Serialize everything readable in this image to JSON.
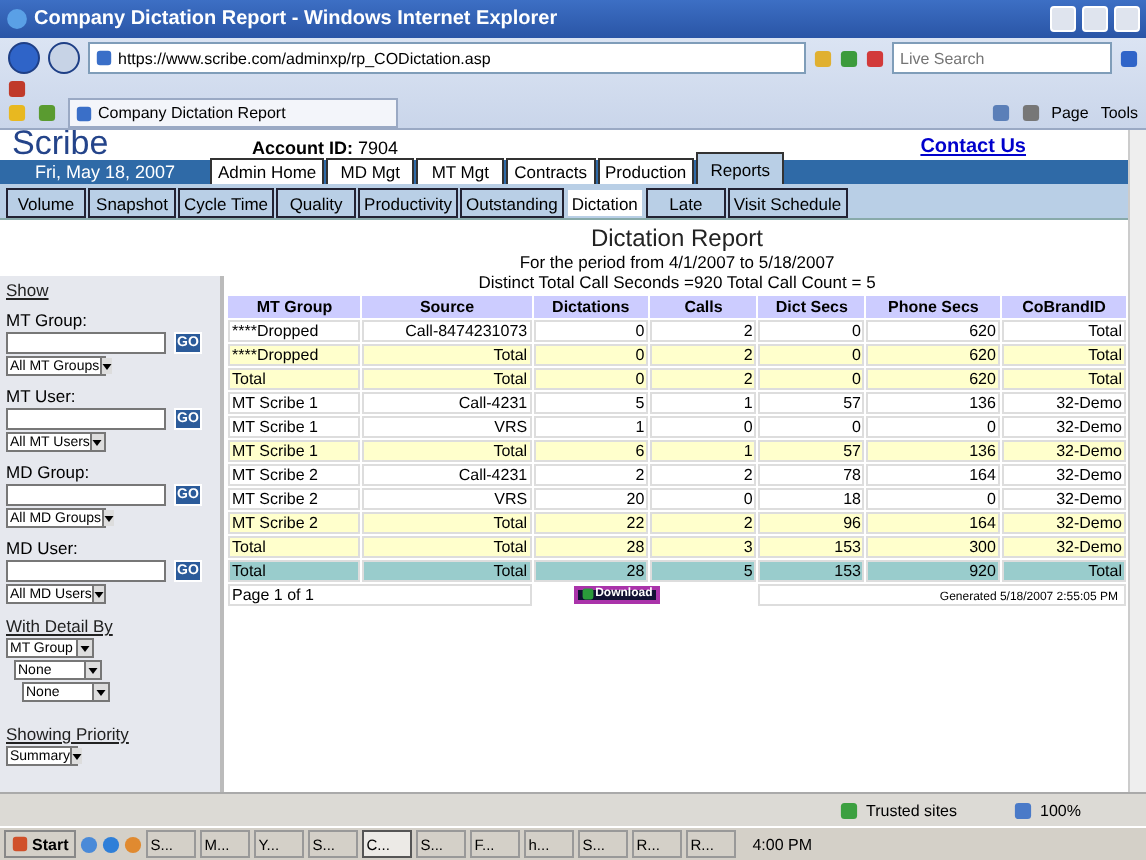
{
  "window": {
    "title": "Company Dictation Report - Windows Internet Explorer"
  },
  "address_bar": {
    "url": "https://www.scribe.com/adminxp/rp_CODictation.asp",
    "search_placeholder": "Live Search"
  },
  "browser_tab": {
    "title": "Company Dictation Report"
  },
  "command_bar": {
    "buttons": [
      "Page",
      "Tools"
    ]
  },
  "header": {
    "logo": "Scribe",
    "account_label": "Account ID:",
    "account_id": "7904",
    "contact_link": "Contact Us",
    "date": "Fri, May 18, 2007"
  },
  "top_tabs": [
    {
      "label": "Admin Home",
      "selected": false
    },
    {
      "label": "MD Mgt",
      "selected": false
    },
    {
      "label": "MT Mgt",
      "selected": false
    },
    {
      "label": "Contracts",
      "selected": false
    },
    {
      "label": "Production",
      "selected": false
    },
    {
      "label": "Reports",
      "selected": true
    }
  ],
  "sub_tabs": [
    {
      "label": "Volume",
      "selected": false
    },
    {
      "label": "Snapshot",
      "selected": false
    },
    {
      "label": "Cycle Time",
      "selected": false
    },
    {
      "label": "Quality",
      "selected": false
    },
    {
      "label": "Productivity",
      "selected": false
    },
    {
      "label": "Outstanding",
      "selected": false
    },
    {
      "label": "Dictation",
      "selected": true
    },
    {
      "label": "Late",
      "selected": false
    },
    {
      "label": "Visit Schedule",
      "selected": false
    }
  ],
  "sidebar": {
    "show_link": "Show",
    "filters": [
      {
        "label": "MT Group:",
        "go": "GO",
        "select": "All MT Groups"
      },
      {
        "label": "MT User:",
        "go": "GO",
        "select": "All MT Users"
      },
      {
        "label": "MD Group:",
        "go": "GO",
        "select": "All MD Groups"
      },
      {
        "label": "MD User:",
        "go": "GO",
        "select": "All MD Users"
      }
    ],
    "detail_label": "With Detail By",
    "detail_selects": [
      "MT Group",
      "None",
      "None"
    ],
    "priority_label": "Showing Priority",
    "priority_select": "Summary"
  },
  "report": {
    "title": "Dictation Report",
    "period": "For the period from 4/1/2007 to 5/18/2007",
    "summary": "Distinct Total Call Seconds =920 Total Call Count = 5",
    "columns": [
      "MT Group",
      "Source",
      "Dictations",
      "Calls",
      "Dict Secs",
      "Phone Secs",
      "CoBrandID"
    ],
    "rows": [
      {
        "kind": "detail",
        "cells": [
          "****Dropped",
          "Call-8474231073",
          "0",
          "2",
          "0",
          "620",
          "Total"
        ]
      },
      {
        "kind": "subtotal",
        "cells": [
          "****Dropped",
          "Total",
          "0",
          "2",
          "0",
          "620",
          "Total"
        ]
      },
      {
        "kind": "subtotal",
        "cells": [
          "Total",
          "Total",
          "0",
          "2",
          "0",
          "620",
          "Total"
        ]
      },
      {
        "kind": "detail",
        "cells": [
          "MT Scribe 1",
          "Call-4231",
          "5",
          "1",
          "57",
          "136",
          "32-Demo"
        ]
      },
      {
        "kind": "detail",
        "cells": [
          "MT Scribe 1",
          "VRS",
          "1",
          "0",
          "0",
          "0",
          "32-Demo"
        ]
      },
      {
        "kind": "subtotal",
        "cells": [
          "MT Scribe 1",
          "Total",
          "6",
          "1",
          "57",
          "136",
          "32-Demo"
        ]
      },
      {
        "kind": "detail",
        "cells": [
          "MT Scribe 2",
          "Call-4231",
          "2",
          "2",
          "78",
          "164",
          "32-Demo"
        ]
      },
      {
        "kind": "detail",
        "cells": [
          "MT Scribe 2",
          "VRS",
          "20",
          "0",
          "18",
          "0",
          "32-Demo"
        ]
      },
      {
        "kind": "subtotal",
        "cells": [
          "MT Scribe 2",
          "Total",
          "22",
          "2",
          "96",
          "164",
          "32-Demo"
        ]
      },
      {
        "kind": "subtotal",
        "cells": [
          "Total",
          "Total",
          "28",
          "3",
          "153",
          "300",
          "32-Demo"
        ]
      },
      {
        "kind": "grand",
        "cells": [
          "Total",
          "Total",
          "28",
          "5",
          "153",
          "920",
          "Total"
        ]
      }
    ],
    "page_info": "Page 1 of 1",
    "download": "Download",
    "generated": "Generated 5/18/2007 2:55:05 PM"
  },
  "status_bar": {
    "zone": "Trusted sites",
    "zoom": "100%"
  },
  "taskbar": {
    "start": "Start",
    "clock": "4:00 PM",
    "buttons": [
      {
        "label": "S...",
        "selected": false
      },
      {
        "label": "M...",
        "selected": false
      },
      {
        "label": "Y...",
        "selected": false
      },
      {
        "label": "S...",
        "selected": false
      },
      {
        "label": "C...",
        "selected": true
      },
      {
        "label": "S...",
        "selected": false
      },
      {
        "label": "F...",
        "selected": false
      },
      {
        "label": "h...",
        "selected": false
      },
      {
        "label": "S...",
        "selected": false
      },
      {
        "label": "R...",
        "selected": false
      },
      {
        "label": "R...",
        "selected": false
      }
    ]
  }
}
